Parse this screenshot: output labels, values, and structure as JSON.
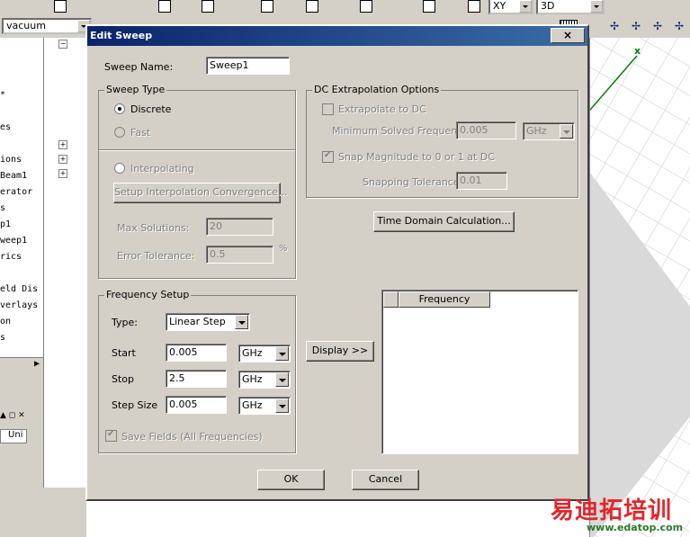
{
  "toolbar": {
    "material_value": "vacuum",
    "plane_value": "XY",
    "view_value": "3D"
  },
  "tree": {
    "lines": [
      "*",
      "es",
      "ions",
      "Beam1",
      "erator",
      "s",
      "p1",
      "weep1",
      "rics",
      "eld Dis",
      "verlays",
      "on",
      "s"
    ]
  },
  "props": {
    "column": "Uni"
  },
  "viewport": {
    "axis_label": "x"
  },
  "dialog": {
    "title": "Edit Sweep",
    "close_glyph": "×",
    "sweep_name_label": "Sweep Name:",
    "sweep_name_value": "Sweep1",
    "sweep_type": {
      "title": "Sweep Type",
      "discrete": "Discrete",
      "fast": "Fast",
      "interpolating": "Interpolating",
      "setup_button": "Setup Interpolation Convergence...",
      "max_solutions_label": "Max Solutions:",
      "max_solutions_value": "20",
      "error_tolerance_label": "Error Tolerance:",
      "error_tolerance_value": "0.5",
      "percent": "%"
    },
    "dc": {
      "title": "DC Extrapolation Options",
      "extrapolate": "Extrapolate to DC",
      "min_freq_label": "Minimum Solved Frequency",
      "min_freq_value": "0.005",
      "min_freq_unit": "GHz",
      "snap": "Snap Magnitude to 0 or 1 at DC",
      "snap_tol_label": "Snapping Tolerance",
      "snap_tol_value": "0.01"
    },
    "time_domain_button": "Time Domain Calculation...",
    "freq": {
      "title": "Frequency Setup",
      "type_label": "Type:",
      "type_value": "Linear Step",
      "start_label": "Start",
      "start_value": "0.005",
      "start_unit": "GHz",
      "stop_label": "Stop",
      "stop_value": "2.5",
      "stop_unit": "GHz",
      "step_label": "Step Size",
      "step_value": "0.005",
      "step_unit": "GHz",
      "save_fields": "Save Fields (All Frequencies)"
    },
    "display_button": "Display >>",
    "list_header": "Frequency",
    "ok": "OK",
    "cancel": "Cancel"
  },
  "watermark": {
    "cn": "易迪拓培训",
    "url": "www.edatop.com"
  },
  "colors": {
    "title_start": "#0a246a",
    "title_end": "#3a6ea5",
    "face": "#d4d0c8",
    "watermark": "#e2262a"
  }
}
